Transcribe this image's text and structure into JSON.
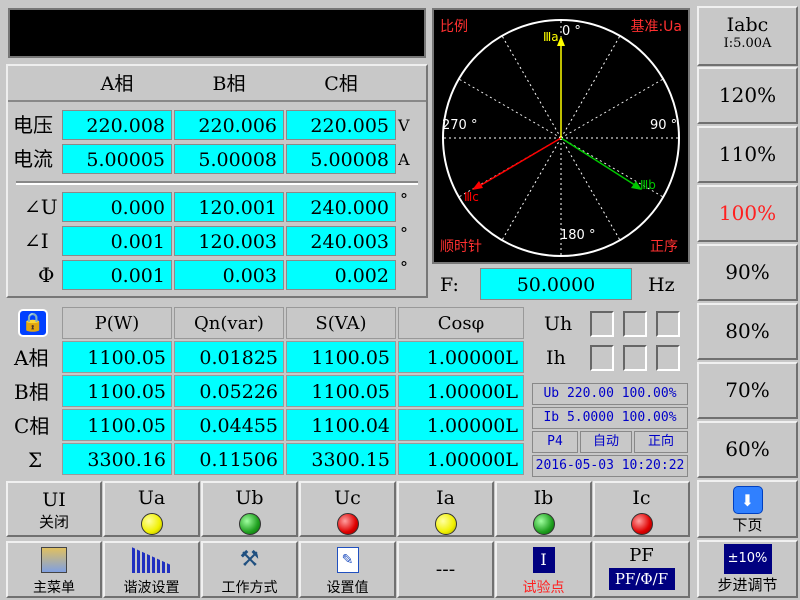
{
  "table": {
    "headers": [
      "A相",
      "B相",
      "C相"
    ],
    "voltage": {
      "label": "电压",
      "values": [
        "220.008",
        "220.006",
        "220.005"
      ],
      "unit": "V"
    },
    "current": {
      "label": "电流",
      "values": [
        "5.00005",
        "5.00008",
        "5.00008"
      ],
      "unit": "A"
    },
    "angle_u": {
      "label": "∠U",
      "values": [
        "0.000",
        "120.001",
        "240.000"
      ],
      "unit": "°"
    },
    "angle_i": {
      "label": "∠I",
      "values": [
        "0.001",
        "120.003",
        "240.003"
      ],
      "unit": "°"
    },
    "phi": {
      "label": "Φ",
      "values": [
        "0.001",
        "0.003",
        "0.002"
      ],
      "unit": "°"
    }
  },
  "vector": {
    "ratio_label": "比例",
    "ref_label": "基准:Ua",
    "clockwise_label": "顺时针",
    "sequence_label": "正序",
    "deg0": "0 °",
    "deg90": "90 °",
    "deg180": "180 °",
    "deg270": "270 °",
    "ua_label": "Ⅲa",
    "ub_label": "Ⅲb",
    "uc_label": "Ⅲc",
    "ua_color": "#ffff00",
    "ub_color": "#00c800",
    "uc_color": "#ff0000"
  },
  "frequency": {
    "label": "F:",
    "value": "50.0000",
    "unit": "Hz"
  },
  "power": {
    "headers": [
      "P(W)",
      "Qn(var)",
      "S(VA)",
      "Cosφ"
    ],
    "rows": [
      {
        "label": "A相",
        "values": [
          "1100.05",
          "0.01825",
          "1100.05",
          "1.00000L"
        ]
      },
      {
        "label": "B相",
        "values": [
          "1100.05",
          "0.05226",
          "1100.05",
          "1.00000L"
        ]
      },
      {
        "label": "C相",
        "values": [
          "1100.05",
          "0.04455",
          "1100.04",
          "1.00000L"
        ]
      },
      {
        "label": "Σ",
        "values": [
          "3300.16",
          "0.11506",
          "3300.15",
          "1.00000L"
        ]
      }
    ]
  },
  "status": {
    "uh_label": "Uh",
    "ih_label": "Ih",
    "ub_line": "Ub 220.00 100.00%",
    "ib_line": "Ib 5.0000 100.00%",
    "p_label": "P4",
    "mode": "自动",
    "direction": "正向",
    "datetime": "2016-05-03 10:20:22"
  },
  "right": {
    "iabc_title": "Iabc",
    "iabc_value": "I:5.00A",
    "levels": [
      "120%",
      "110%",
      "100%",
      "90%",
      "80%",
      "70%",
      "60%"
    ],
    "active_level": "100%",
    "next_label": "下页",
    "step_top": "±10%",
    "step_label": "步进调节"
  },
  "phases": [
    {
      "top": "UI",
      "bottom": "关闭"
    },
    {
      "top": "Ua",
      "color": "#f0f000"
    },
    {
      "top": "Ub",
      "color": "#20a020"
    },
    {
      "top": "Uc",
      "color": "#e00000"
    },
    {
      "top": "Ia",
      "color": "#f0f000"
    },
    {
      "top": "Ib",
      "color": "#20a020"
    },
    {
      "top": "Ic",
      "color": "#e00000"
    }
  ],
  "bottom": {
    "main_menu": "主菜单",
    "harmonic": "谐波设置",
    "work_mode": "工作方式",
    "settings": "设置值",
    "dashes": "---",
    "test_point": "试验点",
    "test_icon": "I",
    "pf_top": "PF",
    "pf_bottom": "PF/Φ/F"
  }
}
